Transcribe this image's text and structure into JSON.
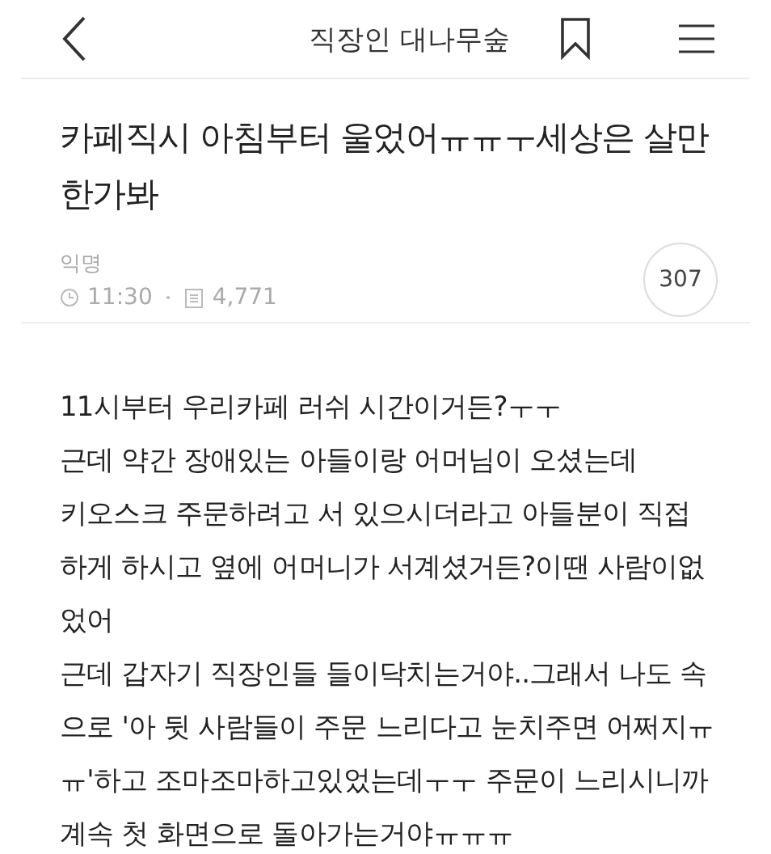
{
  "header": {
    "title": "직장인 대나무숲"
  },
  "post": {
    "title": "카페직시 아침부터 울었어ㅠㅠㅜ세상은 살만한가봐",
    "author": "익명",
    "time": "11:30",
    "views": "4,771",
    "comment_count": "307"
  },
  "body_lines": [
    "11시부터 우리카페 러쉬 시간이거든?ㅜㅜ",
    "근데 약간 장애있는 아들이랑 어머님이 오셨는데",
    "키오스크 주문하려고 서 있으시더라고 아들분이 직접",
    "하게 하시고 옆에 어머니가 서계셨거든?이땐 사람이없",
    "었어",
    "근데 갑자기 직장인들 들이닥치는거야..그래서 나도 속",
    "으로 '아 뒷 사람들이 주문 느리다고 눈치주면 어쩌지ㅠ",
    "ㅠ'하고 조마조마하고있었는데ㅜㅜ 주문이 느리시니까",
    "계속 첫 화면으로 돌아가는거야ㅠㅠㅠ"
  ]
}
